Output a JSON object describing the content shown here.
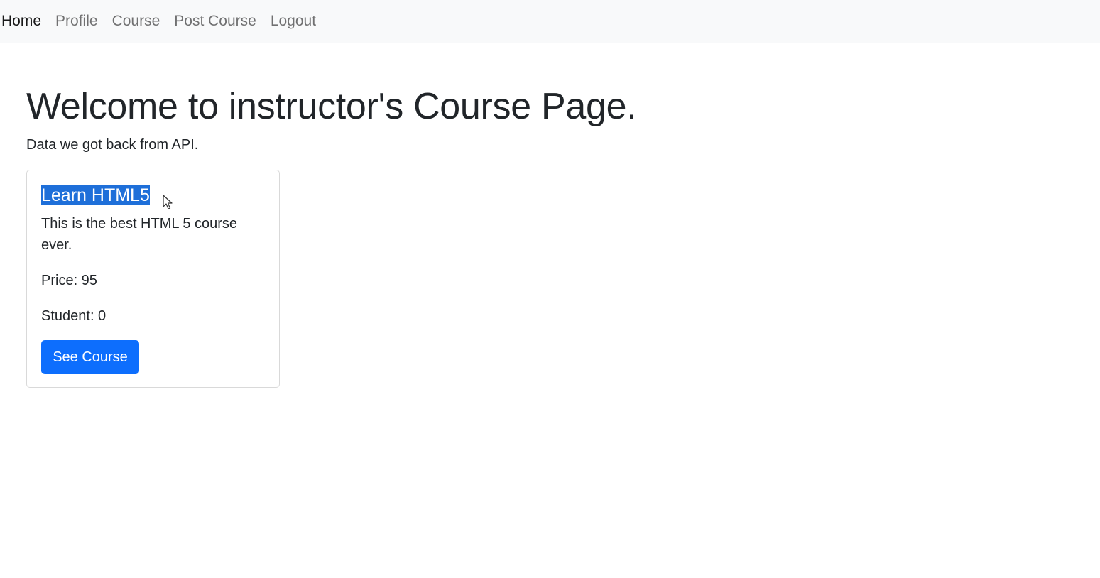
{
  "navbar": {
    "items": [
      {
        "label": "Home",
        "active": true
      },
      {
        "label": "Profile",
        "active": false
      },
      {
        "label": "Course",
        "active": false
      },
      {
        "label": "Post Course",
        "active": false
      },
      {
        "label": "Logout",
        "active": false
      }
    ]
  },
  "main": {
    "title": "Welcome to instructor's Course Page.",
    "subtitle": "Data we got back from API."
  },
  "courses": [
    {
      "title": "Learn HTML5",
      "description": "This is the best HTML 5 course ever.",
      "price_text": "Price: 95",
      "students_text": "Student: 0",
      "button_label": "See Course"
    }
  ],
  "colors": {
    "navbar_bg": "#f8f9fa",
    "primary": "#0d6efd",
    "selection": "#1e6fd9"
  },
  "icons": {
    "cursor": "mouse-pointer-icon"
  }
}
